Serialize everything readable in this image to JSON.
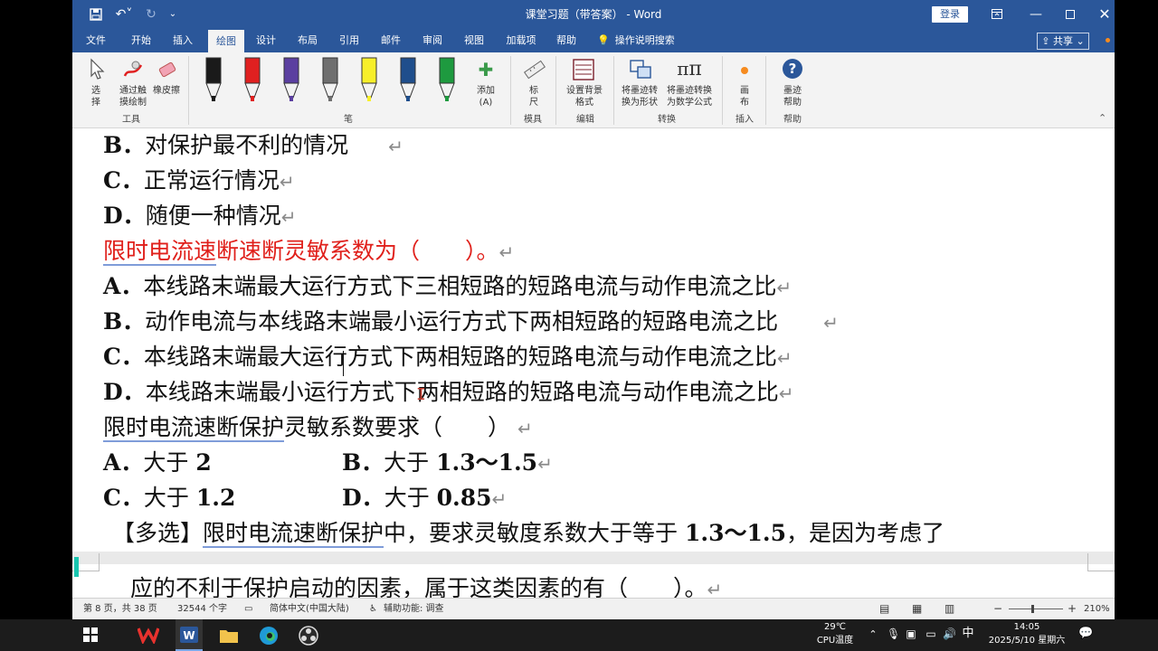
{
  "title_bar": {
    "doc_title": "课堂习题（带答案） - Word",
    "login": "登录",
    "save_icon": "save-icon",
    "undo_icon": "undo-icon",
    "redo_icon": "redo-icon"
  },
  "menu": {
    "tabs": [
      "文件",
      "开始",
      "插入",
      "绘图",
      "设计",
      "布局",
      "引用",
      "邮件",
      "审阅",
      "视图",
      "加载项",
      "帮助"
    ],
    "active_tab": "绘图",
    "tell_me": "操作说明搜索",
    "share": "共享"
  },
  "ribbon": {
    "tools": {
      "select": "选\n择",
      "touch_draw": "通过触\n摸绘制",
      "eraser": "橡皮擦",
      "group": "工具"
    },
    "pens_group": "笔",
    "pen_colors": [
      "#1a1a1a",
      "#e02020",
      "#5b3fa0",
      "#6f6f6f",
      "#f7ef2a",
      "#1f4e8c",
      "#1e9a3f"
    ],
    "add_pen": "添加\n(A)",
    "ruler": "标\n尺",
    "stencils_group": "模具",
    "background": "设置背景\n格式",
    "edit_group": "编辑",
    "ink_to_shape": "将墨迹转\n换为形状",
    "ink_to_math": "将墨迹转换\n为数学公式",
    "convert_group": "转换",
    "canvas": "画\n布",
    "insert_group": "插入",
    "ink_help": "墨迹\n帮助",
    "help_group": "帮助"
  },
  "document": {
    "lines": [
      {
        "label": "B．",
        "text": "对保护最不利的情况"
      },
      {
        "label": "C．",
        "text": "正常运行情况"
      },
      {
        "label": "D．",
        "text": "随便一种情况"
      },
      {
        "label": "",
        "text_a": "限时电流速",
        "text_b": "断速断灵敏系数为（　　）。"
      },
      {
        "label": "A．",
        "text": "本线路末端最大运行方式下三相短路的短路电流与动作电流之比"
      },
      {
        "label": "B．",
        "text": "动作电流与本线路末端最小运行方式下两相短路的短路电流之比"
      },
      {
        "label": "C．",
        "text": "本线路末端最大运行方式下两相短路的短路电流与动作电流之比"
      },
      {
        "label": "D．",
        "text": "本线路末端最小运行方式下两相短路的短路电流与动作电流之比"
      },
      {
        "label": "",
        "text_a": "限时电流速断保护",
        "text_b": "灵敏系数要求（　　）"
      }
    ],
    "opt_a": {
      "label": "A．",
      "text": "大于 ",
      "num": "2"
    },
    "opt_b": {
      "label": "B．",
      "text": "大于 ",
      "num": "1.3～1.5"
    },
    "opt_c": {
      "label": "C．",
      "text": "大于 ",
      "num": "1.2"
    },
    "opt_d": {
      "label": "D．",
      "text": "大于 ",
      "num": "0.85"
    },
    "multi_prefix": "【多选】",
    "multi_a": "限时电流速断保护",
    "multi_b": "中，要求灵敏度系数大于等于 ",
    "multi_num": "1.3～1.5",
    "multi_c": "，是因为考虑了",
    "next_line_partial": "应的不利于保护启动的因素，属于这类因素的有（　　）。"
  },
  "status": {
    "page": "第 8 页，共 38 页",
    "words": "32544 个字",
    "language": "简体中文(中国大陆)",
    "accessibility": "辅助功能: 调查",
    "zoom": "210%"
  },
  "taskbar": {
    "weather_temp": "29℃",
    "weather_label": "CPU温度",
    "ime": "中",
    "time": "14:05",
    "date": "2025/5/10 星期六"
  }
}
